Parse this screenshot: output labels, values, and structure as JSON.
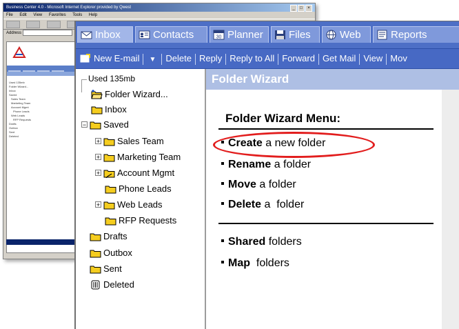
{
  "background_window": {
    "title": "Business Center 4.0 - Microsoft Internet Explorer provided by Qwest",
    "title_buttons": [
      "_",
      "□",
      "×"
    ],
    "menu": [
      "File",
      "Edit",
      "View",
      "Favorites",
      "Tools",
      "Help"
    ],
    "address_label": "Address",
    "tree_items": [
      "Used 135mb",
      "Folder Wizard...",
      "Inbox",
      "Saved",
      "Sales Team",
      "Marketing Team",
      "Account Mgmt",
      "Phone Leads",
      "Web Leads",
      "RFP Requests",
      "Drafts",
      "Outbox",
      "Sent",
      "Deleted"
    ]
  },
  "tabs": [
    {
      "label": "Inbox",
      "icon": "envelope-icon"
    },
    {
      "label": "Contacts",
      "icon": "address-card-icon"
    },
    {
      "label": "Planner",
      "icon": "calendar-icon"
    },
    {
      "label": "Files",
      "icon": "floppy-disk-icon"
    },
    {
      "label": "Web",
      "icon": "globe-icon"
    },
    {
      "label": "Reports",
      "icon": "report-icon"
    }
  ],
  "commands": {
    "new_email": "New E-mail",
    "delete": "Delete",
    "reply": "Reply",
    "reply_all": "Reply to All",
    "forward": "Forward",
    "get_mail": "Get Mail",
    "view": "View",
    "move": "Mov"
  },
  "folders": {
    "used": "Used 135mb",
    "items": [
      {
        "label": "Folder Wizard...",
        "icon": "folder-open-icon"
      },
      {
        "label": "Inbox",
        "icon": "folder-icon"
      },
      {
        "label": "Saved",
        "icon": "folder-icon"
      },
      {
        "label": "Sales Team",
        "icon": "folder-icon"
      },
      {
        "label": "Marketing Team",
        "icon": "folder-icon"
      },
      {
        "label": "Account Mgmt",
        "icon": "shared-folder-icon"
      },
      {
        "label": "Phone Leads",
        "icon": "folder-icon"
      },
      {
        "label": "Web Leads",
        "icon": "folder-icon"
      },
      {
        "label": "RFP Requests",
        "icon": "folder-icon"
      },
      {
        "label": "Drafts",
        "icon": "folder-icon"
      },
      {
        "label": "Outbox",
        "icon": "folder-icon"
      },
      {
        "label": "Sent",
        "icon": "folder-icon"
      },
      {
        "label": "Deleted",
        "icon": "trash-folder-icon"
      }
    ]
  },
  "wizard": {
    "header": "Folder Wizard",
    "menu_title": "Folder Wizard Menu:",
    "items": [
      {
        "action": "Create",
        "rest": " a new folder"
      },
      {
        "action": "Rename",
        "rest": " a folder"
      },
      {
        "action": "Move",
        "rest": " a folder"
      },
      {
        "action": "Delete",
        "rest": " a  folder"
      },
      {
        "action": "Shared",
        "rest": " folders"
      },
      {
        "action": "Map",
        "rest": "  folders"
      }
    ]
  },
  "colors": {
    "tabbar": "#4d6fc6",
    "commandbar": "#4769c4",
    "content_header": "#aebfe4",
    "highlight_ring": "#e21d1d",
    "folder_yellow": "#f5cd1f"
  }
}
